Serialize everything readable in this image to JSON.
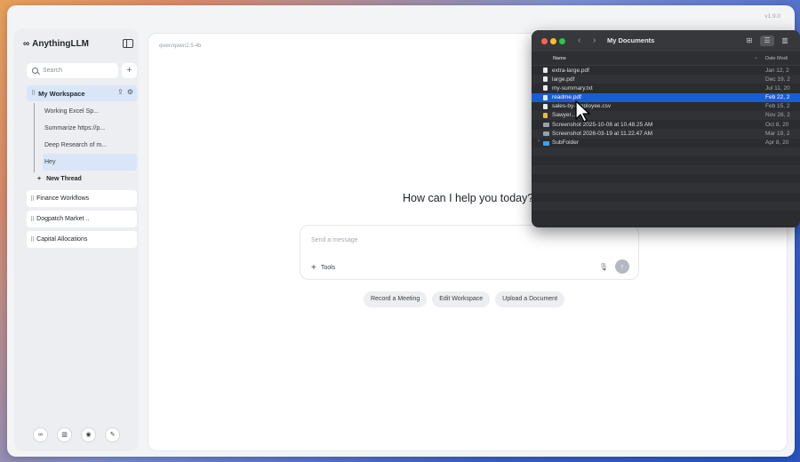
{
  "app": {
    "version": "v1.9.0",
    "brand_logo": "∞",
    "brand_name": "AnythingLLM"
  },
  "sidebar": {
    "search_placeholder": "Search",
    "active_workspace": "My Workspace",
    "threads": [
      "Working Excel Sp...",
      "Summarize https://p...",
      "Deep Research of m...",
      "Hey"
    ],
    "new_thread_label": "New Thread",
    "workspaces": [
      "Finance Workflows",
      "Dogpatch Market ..",
      "Capital Allocations"
    ],
    "footer_icons": [
      "infinity-icon",
      "book-icon",
      "discord-icon",
      "wrench-icon"
    ]
  },
  "main": {
    "model_label": "qwen/qwen2.5-4b",
    "greeting": "How can I help you today?",
    "message_placeholder": "Send a message",
    "tools_label": "Tools",
    "suggestions": [
      "Record a Meeting",
      "Edit Workspace",
      "Upload a Document"
    ]
  },
  "finder": {
    "title": "My Documents",
    "col_name": "Name",
    "col_date": "Date Modi",
    "files": [
      {
        "name": "extra-large.pdf",
        "date": "Jan 12, 2",
        "icon": "doc",
        "selected": false
      },
      {
        "name": "large.pdf",
        "date": "Dec 19, 2",
        "icon": "doc",
        "selected": false
      },
      {
        "name": "my-summary.txt",
        "date": "Jul 11, 20",
        "icon": "doc",
        "selected": false
      },
      {
        "name": "readme.pdf",
        "date": "Feb 22, 2",
        "icon": "doc",
        "selected": true
      },
      {
        "name": "sales-by-employee.csv",
        "date": "Feb 15, 2",
        "icon": "doc",
        "selected": false
      },
      {
        "name": "Sawyer...",
        "date": "Nov 26, 2",
        "icon": "yellow-doc",
        "selected": false
      },
      {
        "name": "Screenshot 2025-10-08 at 10.48.25 AM",
        "date": "Oct 8, 20",
        "icon": "image",
        "selected": false
      },
      {
        "name": "Screenshot 2026-03-19 at 11.22.47 AM",
        "date": "Mar 19, 2",
        "icon": "image",
        "selected": false
      },
      {
        "name": "SubFolder",
        "date": "Apr 8, 20",
        "icon": "folder",
        "selected": false
      }
    ]
  },
  "colors": {
    "accent_selection": "#1d5bd6",
    "workspace_highlight": "#d9e6f8"
  }
}
